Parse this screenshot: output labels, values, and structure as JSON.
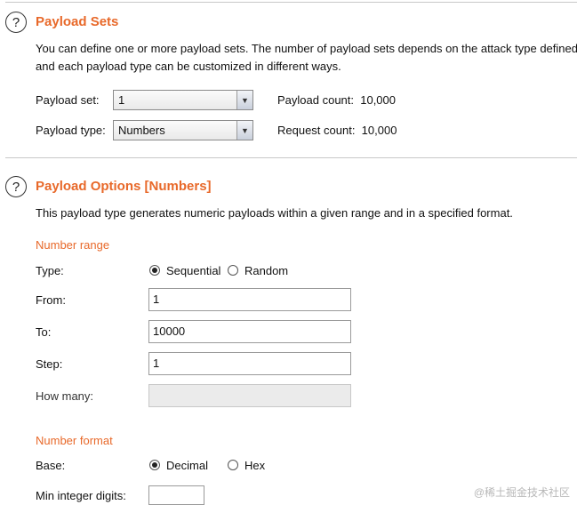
{
  "payload_sets": {
    "title": "Payload Sets",
    "description_line1": "You can define one or more payload sets. The number of payload sets depends on the attack type defined",
    "description_line2": "and each payload type can be customized in different ways.",
    "set_label": "Payload set:",
    "set_value": "1",
    "type_label": "Payload type:",
    "type_value": "Numbers",
    "payload_count": "Payload count:  10,000",
    "request_count": "Request count:  10,000"
  },
  "payload_options": {
    "title": "Payload Options [Numbers]",
    "description": "This payload type generates numeric payloads within a given range and in a specified format.",
    "number_range": {
      "title": "Number range",
      "type_label": "Type:",
      "sequential_label": "Sequential",
      "random_label": "Random",
      "selected": "Sequential",
      "from_label": "From:",
      "from_value": "1",
      "to_label": "To:",
      "to_value": "10000",
      "step_label": "Step:",
      "step_value": "1",
      "how_many_label": "How many:",
      "how_many_value": ""
    },
    "number_format": {
      "title": "Number format",
      "base_label": "Base:",
      "decimal_label": "Decimal",
      "hex_label": "Hex",
      "selected": "Decimal",
      "min_integer_digits_label": "Min integer digits:",
      "min_integer_digits_value": ""
    }
  },
  "watermark": "@稀土掘金技术社区"
}
